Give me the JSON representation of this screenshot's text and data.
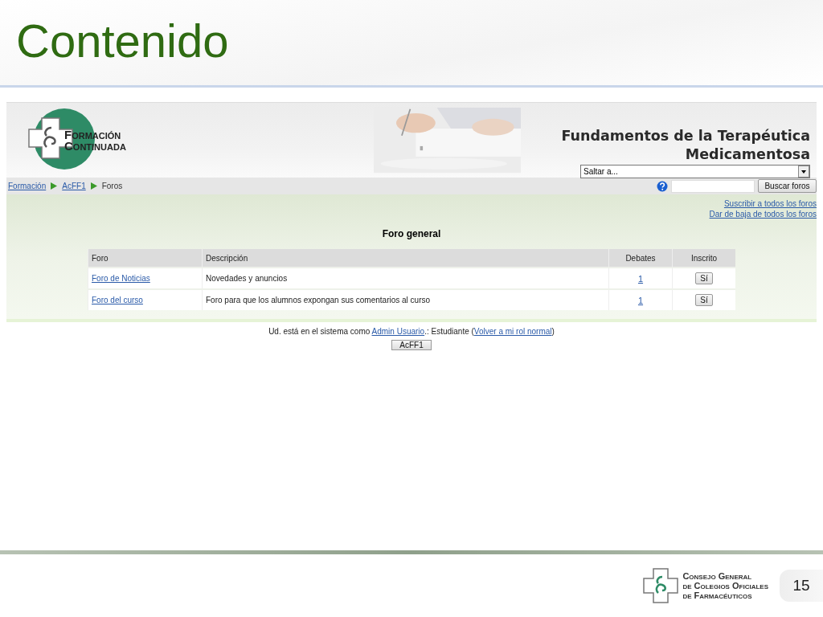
{
  "slide": {
    "title": "Contenido",
    "page_number": "15",
    "footer_logo": {
      "lines": [
        "Consejo General",
        "de Colegios Oficiales",
        "de Farmacéuticos"
      ]
    }
  },
  "site": {
    "logo": {
      "lines": [
        "Formación",
        "Continuada"
      ]
    },
    "course_title": "Fundamentos de la Terapéutica Medicamentosa",
    "jump_menu": {
      "value": "Saltar a..."
    }
  },
  "breadcrumb": [
    {
      "label": "Formación",
      "link": true
    },
    {
      "label": "AcFF1",
      "link": true
    },
    {
      "label": "Foros",
      "link": false
    }
  ],
  "search": {
    "button": "Buscar foros"
  },
  "links": [
    "Suscribir a todos los foros",
    "Dar de baja de todos los foros"
  ],
  "forum_section": {
    "heading": "Foro general",
    "columns": [
      "Foro",
      "Descripción",
      "Debates",
      "Inscrito"
    ],
    "rows": [
      {
        "forum": "Foro de Noticias",
        "description": "Novedades y anuncios",
        "debates": "1",
        "subscribed": "Sí"
      },
      {
        "forum": "Foro del curso",
        "description": "Foro para que los alumnos expongan sus comentarios al curso",
        "debates": "1",
        "subscribed": "Sí"
      }
    ]
  },
  "role_notice": {
    "parts": [
      {
        "kind": "text",
        "text": "Ud. está en el sistema como "
      },
      {
        "kind": "link",
        "text": "Admin Usuario"
      },
      {
        "kind": "text",
        "text": ".: Estudiante ("
      },
      {
        "kind": "link",
        "text": "Volver a mi rol normal"
      },
      {
        "kind": "text",
        "text": ")"
      }
    ]
  },
  "course_button": "AcFF1"
}
